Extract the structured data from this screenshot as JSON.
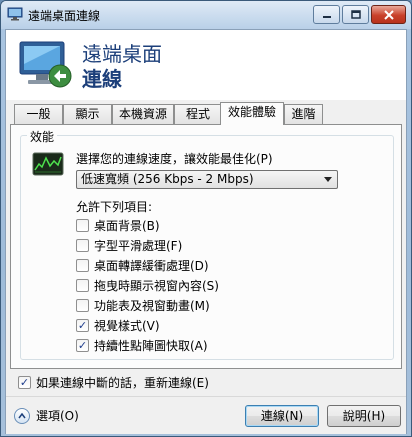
{
  "window": {
    "title": "遠端桌面連線",
    "colors": {
      "title_accent": "#1c3f7a",
      "check": "#1e3c8c"
    }
  },
  "header": {
    "line1": "遠端桌面",
    "line2": "連線",
    "icon": "remote-desktop-icon"
  },
  "tabs": [
    {
      "label": "一般"
    },
    {
      "label": "顯示"
    },
    {
      "label": "本機資源"
    },
    {
      "label": "程式"
    },
    {
      "label": "效能體驗",
      "active": true
    },
    {
      "label": "進階"
    }
  ],
  "performance": {
    "group_label": "效能",
    "speed_prompt": "選擇您的連線速度，讓效能最佳化(P)",
    "speed_selected": "低速寬頻 (256 Kbps - 2 Mbps)",
    "allow_label": "允許下列項目:",
    "options": [
      {
        "label": "桌面背景(B)",
        "checked": false
      },
      {
        "label": "字型平滑處理(F)",
        "checked": false
      },
      {
        "label": "桌面轉譯緩衝處理(D)",
        "checked": false
      },
      {
        "label": "拖曳時顯示視窗內容(S)",
        "checked": false
      },
      {
        "label": "功能表及視窗動畫(M)",
        "checked": false
      },
      {
        "label": "視覺樣式(V)",
        "checked": true
      },
      {
        "label": "持續性點陣圖快取(A)",
        "checked": true
      }
    ]
  },
  "reconnect": {
    "label": "如果連線中斷的話，重新連線(E)",
    "checked": true
  },
  "footer": {
    "options_label": "選項(O)",
    "connect_label": "連線(N)",
    "help_label": "說明(H)"
  }
}
